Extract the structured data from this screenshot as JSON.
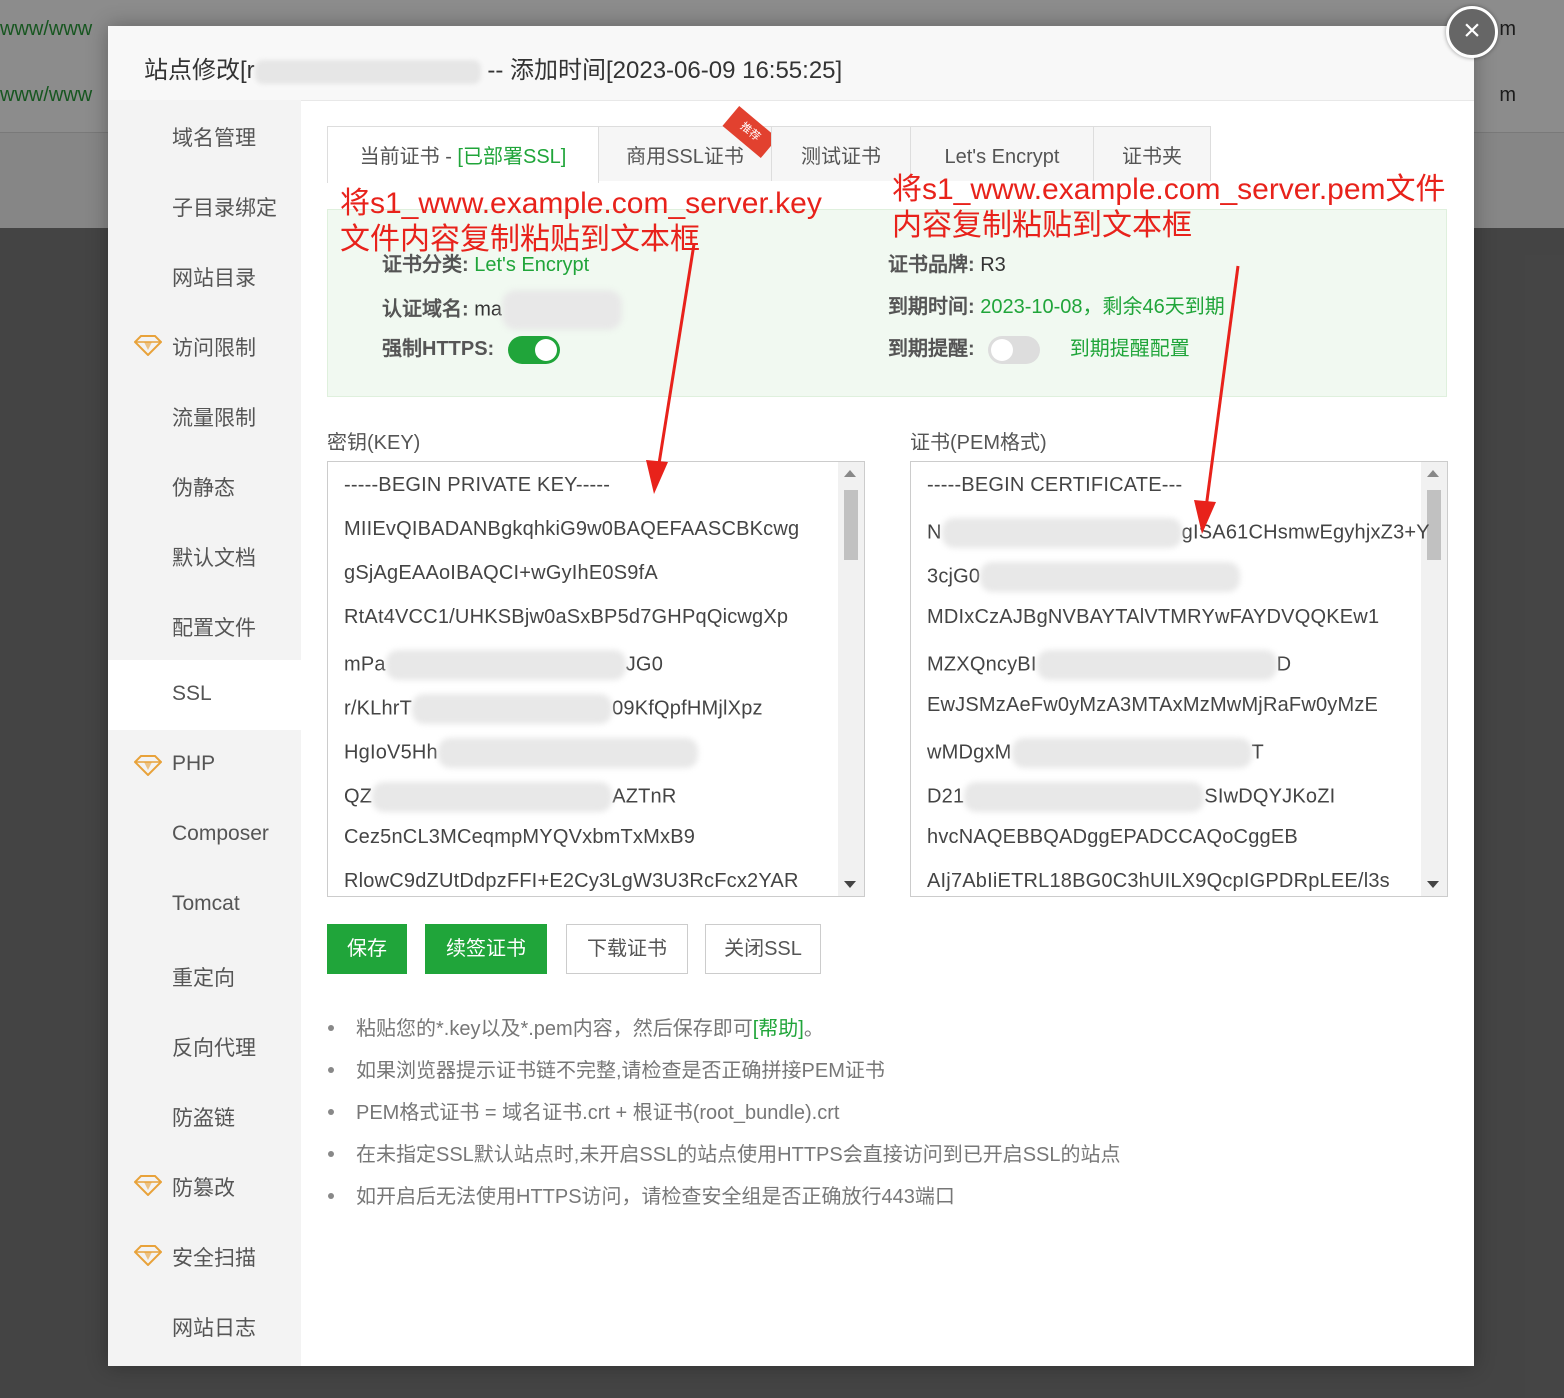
{
  "background": {
    "rows": [
      {
        "left": "www/www",
        "right": "m"
      },
      {
        "left": "www/www",
        "right": "m"
      }
    ]
  },
  "modal": {
    "title_prefix": "站点修改[r",
    "title_suffix": "-- 添加时间[2023-06-09 16:55:25]",
    "close_glyph": "×"
  },
  "sidebar": {
    "items": [
      {
        "label": "域名管理",
        "gem": false
      },
      {
        "label": "子目录绑定",
        "gem": false
      },
      {
        "label": "网站目录",
        "gem": false
      },
      {
        "label": "访问限制",
        "gem": true
      },
      {
        "label": "流量限制",
        "gem": false
      },
      {
        "label": "伪静态",
        "gem": false
      },
      {
        "label": "默认文档",
        "gem": false
      },
      {
        "label": "配置文件",
        "gem": false
      },
      {
        "label": "SSL",
        "gem": false,
        "active": true
      },
      {
        "label": "PHP",
        "gem": true
      },
      {
        "label": "Composer",
        "gem": false
      },
      {
        "label": "Tomcat",
        "gem": false
      },
      {
        "label": "重定向",
        "gem": false
      },
      {
        "label": "反向代理",
        "gem": false
      },
      {
        "label": "防盗链",
        "gem": false
      },
      {
        "label": "防篡改",
        "gem": true
      },
      {
        "label": "安全扫描",
        "gem": true
      },
      {
        "label": "网站日志",
        "gem": false
      }
    ]
  },
  "tabs": {
    "current_prefix": "当前证书 - ",
    "current_status": "[已部署SSL]",
    "commercial": "商用SSL证书",
    "commercial_badge": "推荐",
    "test": "测试证书",
    "letsencrypt": "Let's Encrypt",
    "folder": "证书夹"
  },
  "info": {
    "type_label": "证书分类:",
    "type_value": "Let's Encrypt",
    "brand_label": "证书品牌:",
    "brand_value": "R3",
    "domain_label": "认证域名:",
    "domain_value": "ma",
    "expire_label": "到期时间:",
    "expire_value": "2023-10-08，剩余46天到期",
    "https_label": "强制HTTPS:",
    "https_on": true,
    "remind_label": "到期提醒:",
    "remind_on": false,
    "remind_link": "到期提醒配置"
  },
  "key_field": {
    "label": "密钥(KEY)",
    "lines": [
      "-----BEGIN PRIVATE KEY-----",
      "MIIEvQIBADANBgkqhkiG9w0BAQEFAASCBKcwg",
      "gSjAgEAAoIBAQCI+wGyIhE0S9fA",
      "RtAt4VCC1/UHKSBjw0aSxBP5d7GHPqQicwgXp",
      "mPa",
      "r/KLhrT",
      "HgIoV5Hh",
      "QZ",
      "Cez5nCL3MCeqmpMYQVxbmTxMxB9",
      "RlowC9dZUtDdpzFFI+E2Cy3LgW3U3RcFcx2YAR"
    ],
    "line_tails": [
      "",
      "",
      "",
      "",
      "JG0",
      "09KfQpfHMjlXpz",
      "",
      "AZTnR",
      "",
      ""
    ]
  },
  "cert_field": {
    "label": "证书(PEM格式)",
    "lines": [
      "-----BEGIN CERTIFICATE---",
      "N",
      "3cjG0",
      "MDIxCzAJBgNVBAYTAlVTMRYwFAYDVQQKEw1",
      "MZXQncyBI",
      "EwJSMzAeFw0yMzA3MTAxMzMwMjRaFw0yMzE",
      "wMDgxM",
      "D21",
      "hvcNAQEBBQADggEPADCCAQoCggEB",
      "AIj7AbIiETRL18BG0C3hUILX9QcpIGPDRpLEE/l3s"
    ],
    "line_tails": [
      "",
      "gISA61CHsmwEgyhjxZ3+Y",
      "",
      "",
      "D",
      "",
      "T",
      "SIwDQYJKoZI",
      "",
      ""
    ]
  },
  "buttons": {
    "save": "保存",
    "renew": "续签证书",
    "download": "下载证书",
    "close_ssl": "关闭SSL"
  },
  "notes": {
    "n1_pre": "粘贴您的*.key以及*.pem内容，然后保存即可",
    "n1_help": "[帮助]",
    "n1_post": "。",
    "n2": "如果浏览器提示证书链不完整,请检查是否正确拼接PEM证书",
    "n3": "PEM格式证书 = 域名证书.crt + 根证书(root_bundle).crt",
    "n4": "在未指定SSL默认站点时,未开启SSL的站点使用HTTPS会直接访问到已开启SSL的站点",
    "n5": "如开启后无法使用HTTPS访问，请检查安全组是否正确放行443端口"
  },
  "annotations": {
    "left_line1": "将s1_www.example.com_server.key",
    "left_line2": "文件内容复制粘贴到文本框",
    "right_line1": "将s1_www.example.com_server.pem文件",
    "right_line2": "内容复制粘贴到文本框"
  },
  "colors": {
    "accent": "#20a53a",
    "annotation": "#e8221b",
    "gem": "#e8a23a"
  }
}
